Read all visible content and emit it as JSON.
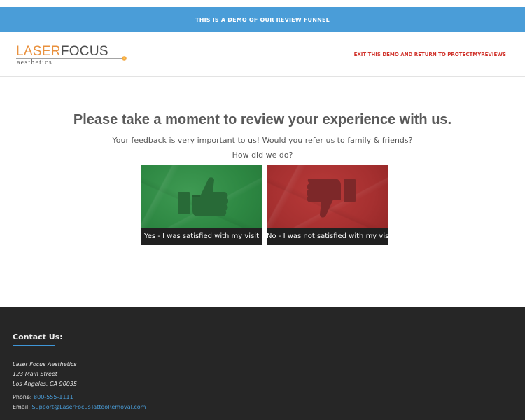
{
  "colors": {
    "banner": "#4a9dd8",
    "logo_orange": "#e9913e",
    "logo_dark": "#4d4d4d",
    "exit_red": "#d0332c",
    "positive_green": "#2d8742",
    "negative_red": "#a63030",
    "caption_bg": "#202020",
    "footer_bg": "#262626",
    "link_blue": "#4a9dd8"
  },
  "banner": {
    "text": "THIS IS A DEMO OF OUR REVIEW FUNNEL"
  },
  "header": {
    "logo": {
      "word_primary": "LASER",
      "word_secondary": "FOCUS",
      "subtitle": "aesthetics"
    },
    "exit_link": "EXIT THIS DEMO AND RETURN TO PROTECTMYREVIEWS"
  },
  "review": {
    "headline": "Please take a moment to review your experience with us.",
    "subtext": "Your feedback is very important to us! Would you refer us to family & friends?",
    "question": "How did we do?",
    "choices": [
      {
        "icon": "thumbs-up-icon",
        "label": "Yes - I was satisfied with my visit"
      },
      {
        "icon": "thumbs-down-icon",
        "label": "No - I was not satisfied with my visit"
      }
    ]
  },
  "footer": {
    "contact_title": "Contact Us:",
    "business_name": "Laser Focus Aesthetics",
    "street": "123 Main Street",
    "city_state_zip": "Los Angeles, CA 90035",
    "phone_label": "Phone:",
    "phone": "800-555-1111",
    "email_label": "Email:",
    "email": "Support@LaserFocusTattooRemoval.com"
  }
}
